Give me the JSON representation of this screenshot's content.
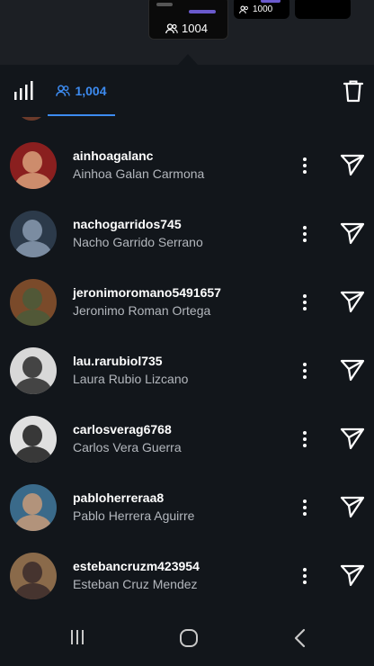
{
  "story_strip": {
    "cards": [
      {
        "viewer_count": "1004",
        "active": true
      },
      {
        "viewer_count": "1000",
        "active": false
      },
      {
        "viewer_count": "",
        "active": false
      }
    ]
  },
  "toolbar": {
    "stats_icon": "bar-chart-icon",
    "viewers_tab": {
      "icon": "people-icon",
      "count": "1,004"
    },
    "delete_icon": "trash-icon",
    "accent_color": "#3d8bf0"
  },
  "viewers": [
    {
      "username": "ainhoagalanc",
      "full_name": "Ainhoa Galan Carmona",
      "avatar_color": "#8a1f1f",
      "avatar_accent": "#d8a07a"
    },
    {
      "username": "nachogarridos745",
      "full_name": "Nacho Garrido Serrano",
      "avatar_color": "#2c3a4a",
      "avatar_accent": "#8a9bb0"
    },
    {
      "username": "jeronimoromano5491657",
      "full_name": "Jeronimo Roman Ortega",
      "avatar_color": "#7a4a2a",
      "avatar_accent": "#4a5a3a"
    },
    {
      "username": "lau.rarubiol735",
      "full_name": "Laura Rubio Lizcano",
      "avatar_color": "#d8d8d8",
      "avatar_accent": "#2a2a2a"
    },
    {
      "username": "carlosverag6768",
      "full_name": "Carlos Vera Guerra",
      "avatar_color": "#e0e0e0",
      "avatar_accent": "#1a1a1a"
    },
    {
      "username": "pabloherreraa8",
      "full_name": "Pablo Herrera Aguirre",
      "avatar_color": "#3a6a8a",
      "avatar_accent": "#c89a78"
    },
    {
      "username": "estebancruzm423954",
      "full_name": "Esteban Cruz Mendez",
      "avatar_color": "#8a6a4a",
      "avatar_accent": "#3a2a2a"
    }
  ],
  "row_actions": {
    "more_icon": "more-vertical-icon",
    "send_icon": "send-icon"
  },
  "navbar": {
    "recents_icon": "recents-icon",
    "home_icon": "home-icon",
    "back_icon": "back-icon"
  }
}
